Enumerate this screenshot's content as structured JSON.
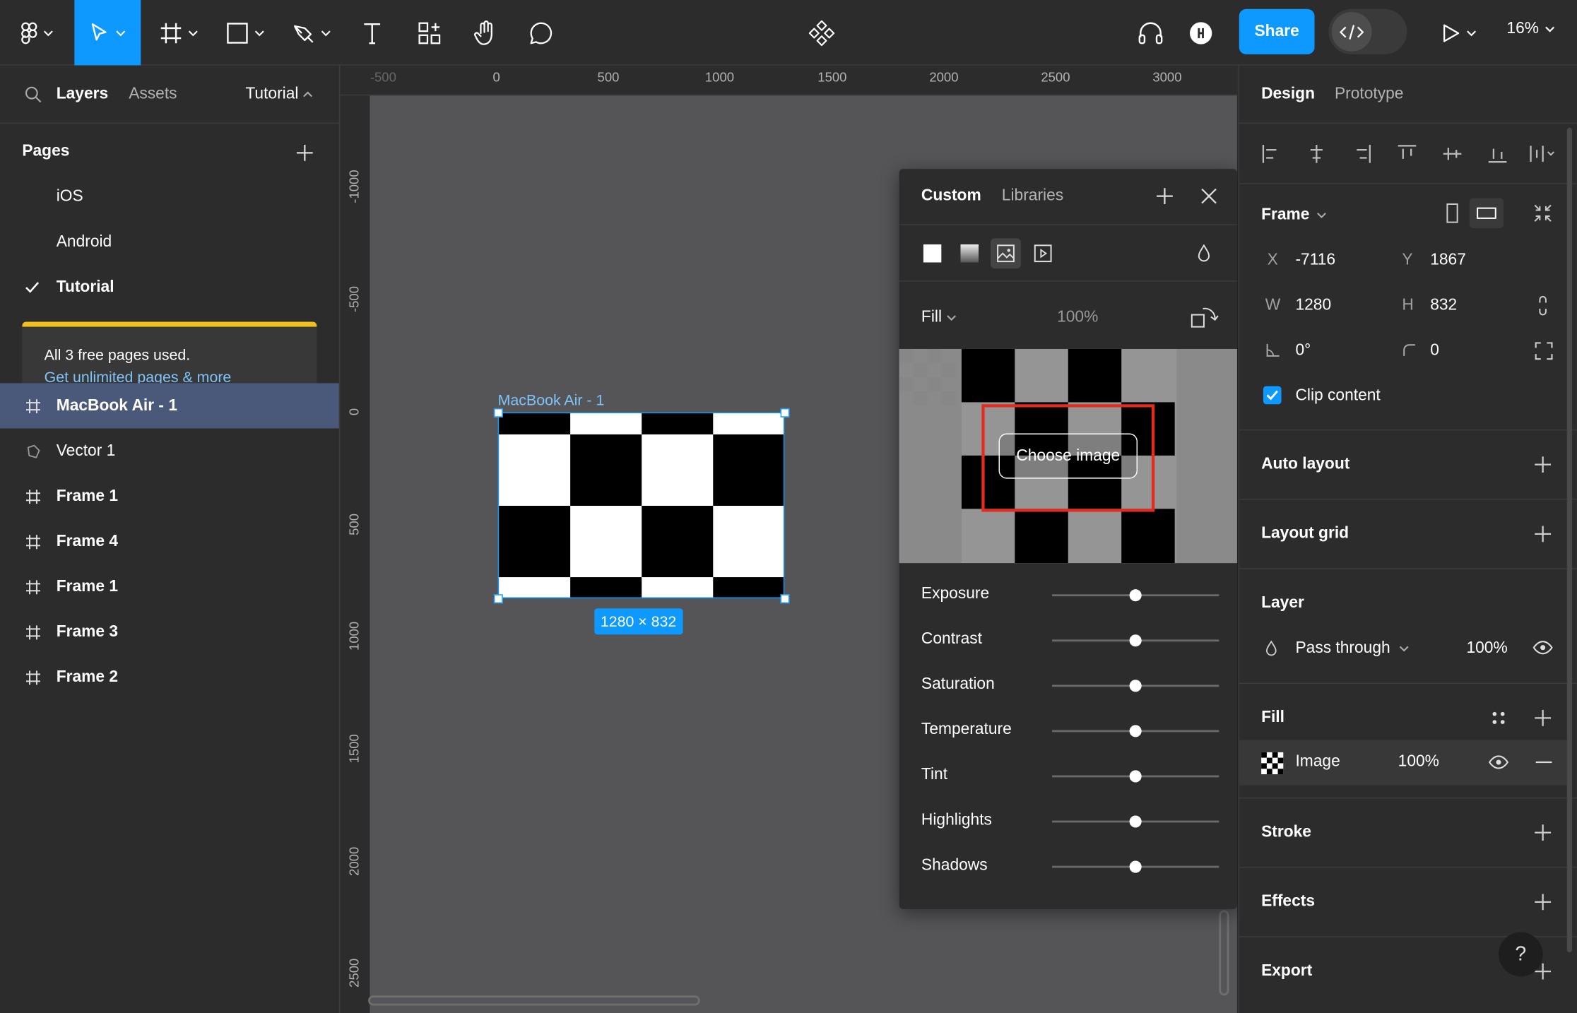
{
  "toolbar": {
    "share_label": "Share",
    "zoom": "16%"
  },
  "left_panel": {
    "tabs": {
      "layers": "Layers",
      "assets": "Assets",
      "page_menu": "Tutorial"
    },
    "pages_title": "Pages",
    "pages": [
      "iOS",
      "Android",
      "Tutorial"
    ],
    "notice": {
      "text": "All 3 free pages used.",
      "link": "Get unlimited pages & more"
    },
    "layers": [
      {
        "name": "MacBook Air - 1",
        "type": "frame"
      },
      {
        "name": "Vector 1",
        "type": "vector"
      },
      {
        "name": "Frame 1",
        "type": "frame"
      },
      {
        "name": "Frame 4",
        "type": "frame"
      },
      {
        "name": "Frame 1",
        "type": "frame"
      },
      {
        "name": "Frame 3",
        "type": "frame"
      },
      {
        "name": "Frame 2",
        "type": "frame"
      }
    ]
  },
  "canvas": {
    "ruler_x": [
      "-500",
      "0",
      "500",
      "1000",
      "1500",
      "2000",
      "2500",
      "3000"
    ],
    "ruler_y": [
      "-1000",
      "-500",
      "0",
      "500",
      "1000",
      "1500",
      "2000",
      "2500"
    ],
    "frame_label": "MacBook Air - 1",
    "frame_size": "1280 × 832"
  },
  "fill_panel": {
    "tabs": {
      "custom": "Custom",
      "libraries": "Libraries"
    },
    "fill_mode": "Fill",
    "opacity": "100%",
    "choose_image": "Choose image",
    "adjustments": [
      {
        "label": "Exposure",
        "value": 0.5
      },
      {
        "label": "Contrast",
        "value": 0.5
      },
      {
        "label": "Saturation",
        "value": 0.5
      },
      {
        "label": "Temperature",
        "value": 0.5
      },
      {
        "label": "Tint",
        "value": 0.5
      },
      {
        "label": "Highlights",
        "value": 0.5
      },
      {
        "label": "Shadows",
        "value": 0.5
      }
    ]
  },
  "right_panel": {
    "tabs": {
      "design": "Design",
      "prototype": "Prototype"
    },
    "frame": {
      "title": "Frame",
      "x_label": "X",
      "x": "-7116",
      "y_label": "Y",
      "y": "1867",
      "w_label": "W",
      "w": "1280",
      "h_label": "H",
      "h": "832",
      "rotation": "0°",
      "radius": "0",
      "clip_content": "Clip content"
    },
    "auto_layout": "Auto layout",
    "layout_grid": "Layout grid",
    "layer": {
      "title": "Layer",
      "blend": "Pass through",
      "opacity": "100%"
    },
    "fill": {
      "title": "Fill",
      "type": "Image",
      "opacity": "100%"
    },
    "stroke": "Stroke",
    "effects": "Effects",
    "export": "Export",
    "help": "?"
  },
  "colors": {
    "accent": "#0d99ff",
    "panel": "#2c2c2c",
    "canvas": "#555558",
    "selected_layer": "#4a5879",
    "notice_bar": "#f2c01c",
    "highlight": "#e52b1e"
  }
}
